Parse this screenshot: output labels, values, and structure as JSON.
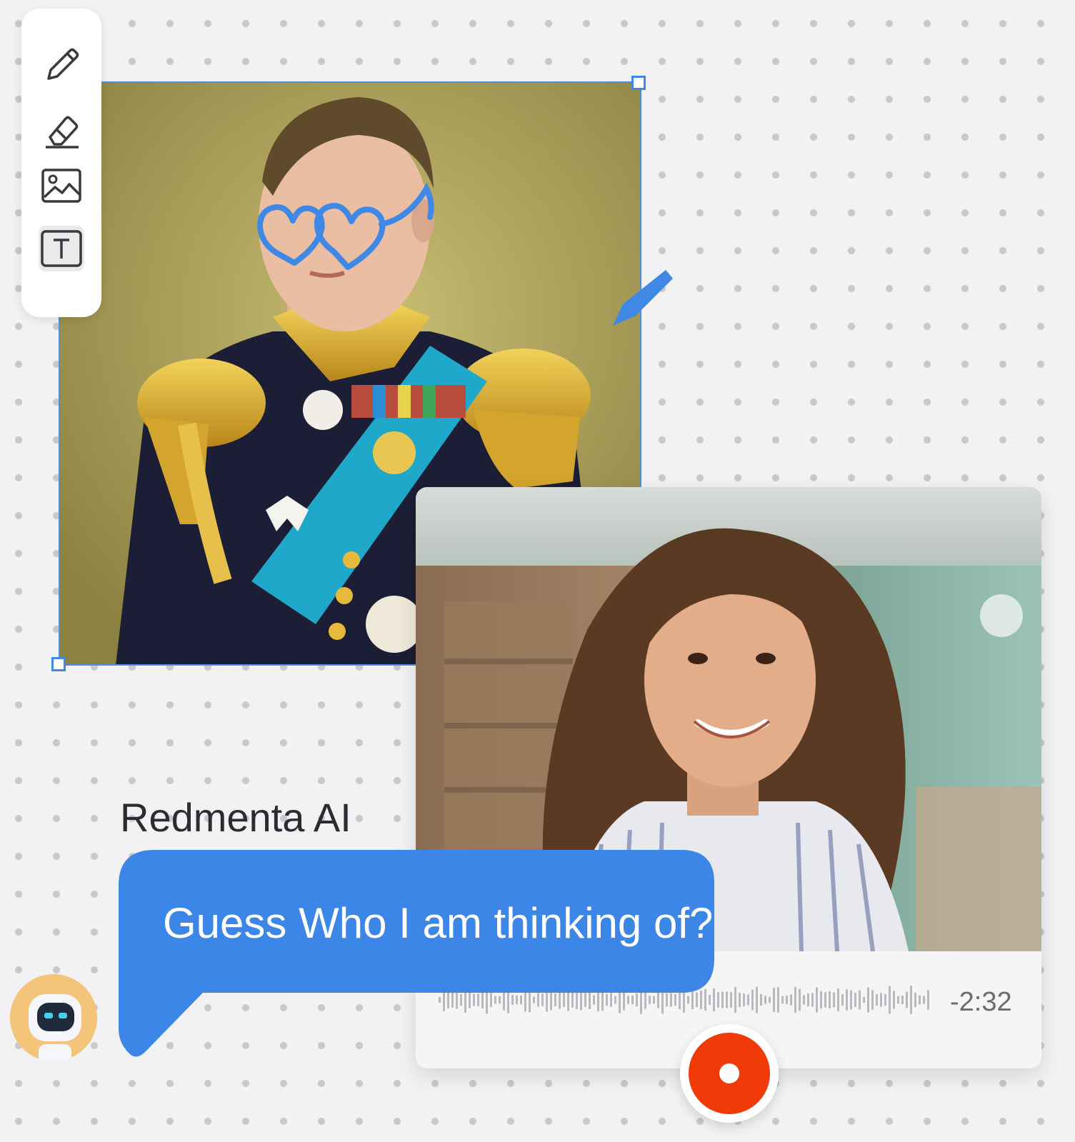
{
  "toolbar": {
    "tools": [
      {
        "name": "pencil",
        "icon": "pencil-icon",
        "active": false
      },
      {
        "name": "eraser",
        "icon": "eraser-icon",
        "active": false
      },
      {
        "name": "image",
        "icon": "image-icon",
        "active": false
      },
      {
        "name": "text",
        "icon": "text-icon",
        "active": true
      }
    ]
  },
  "canvas": {
    "image_description_icon": "portrait-image",
    "drawing_color": "#3f88e6"
  },
  "video": {
    "remaining_time": "-2:32",
    "record_button_color": "#f03a08"
  },
  "chat": {
    "sender": "Redmenta AI",
    "message": "Guess Who I am thinking of?",
    "bubble_color": "#3c86e8",
    "avatar_icon": "robot-avatar"
  }
}
